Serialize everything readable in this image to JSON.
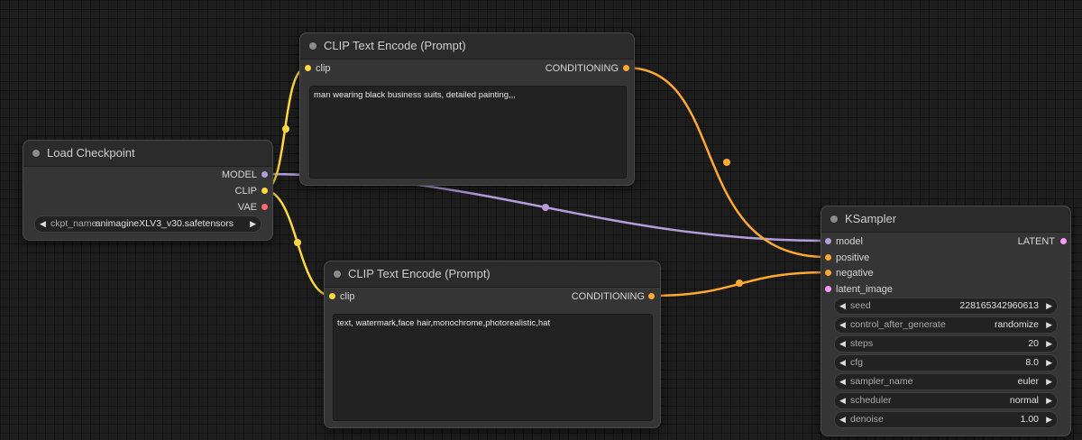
{
  "colors": {
    "canvas": "#1d1d1d",
    "node_body": "#353535",
    "node_title": "#2b2b2b",
    "clip_link": "#ffd83d",
    "conditioning_link": "#ffa931",
    "model_link": "#b39ddb",
    "latent_slot": "#ff9cf9"
  },
  "nodes": {
    "load_checkpoint": {
      "title": "Load Checkpoint",
      "outputs": [
        "MODEL",
        "CLIP",
        "VAE"
      ],
      "widget": {
        "label": "ckpt_name",
        "value": "animagineXLV3_v30.safetensors"
      }
    },
    "clip_pos": {
      "title": "CLIP Text Encode (Prompt)",
      "input": "clip",
      "output": "CONDITIONING",
      "text": "man wearing black business suits, detailed painting,,,"
    },
    "clip_neg": {
      "title": "CLIP Text Encode (Prompt)",
      "input": "clip",
      "output": "CONDITIONING",
      "text": "text, watermark,face hair,monochrome,photorealistic,hat"
    },
    "ksampler": {
      "title": "KSampler",
      "inputs": [
        "model",
        "positive",
        "negative",
        "latent_image"
      ],
      "output": "LATENT",
      "widgets": [
        {
          "label": "seed",
          "value": "228165342960613"
        },
        {
          "label": "control_after_generate",
          "value": "randomize"
        },
        {
          "label": "steps",
          "value": "20"
        },
        {
          "label": "cfg",
          "value": "8.0"
        },
        {
          "label": "sampler_name",
          "value": "euler"
        },
        {
          "label": "scheduler",
          "value": "normal"
        },
        {
          "label": "denoise",
          "value": "1.00"
        }
      ]
    }
  },
  "arrows": {
    "left": "◀",
    "right": "▶"
  }
}
